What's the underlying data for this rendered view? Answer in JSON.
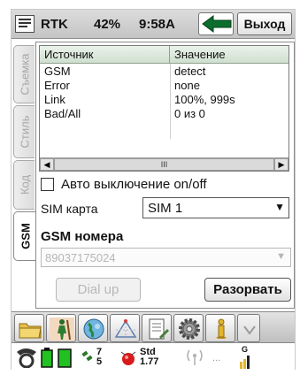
{
  "titlebar": {
    "app_name": "RTK",
    "battery": "42%",
    "time": "9:58A",
    "exit_label": "Выход"
  },
  "tabs": [
    {
      "label": "Съемка",
      "active": false
    },
    {
      "label": "Стиль",
      "active": false
    },
    {
      "label": "Код",
      "active": false
    },
    {
      "label": "GSM",
      "active": true
    }
  ],
  "grid": {
    "headers": [
      "Источник",
      "Значение"
    ],
    "rows": [
      [
        "GSM",
        "detect"
      ],
      [
        "Error",
        "none"
      ],
      [
        "Link",
        "100%, 999s"
      ],
      [
        "Bad/All",
        "0 из 0"
      ]
    ]
  },
  "auto_off_label": "Авто выключение on/off",
  "auto_off_checked": false,
  "sim": {
    "label": "SIM карта",
    "value": "SIM 1"
  },
  "gsm_numbers": {
    "title": "GSM номера",
    "value": "89037175024"
  },
  "buttons": {
    "dial": "Dial up",
    "break": "Разорвать"
  },
  "toolbar_icons": [
    "folder-icon",
    "surveyor-icon",
    "globe-icon",
    "cogo-icon",
    "notebook-icon",
    "settings-gear-icon",
    "info-icon"
  ],
  "status": {
    "sats_top": "7",
    "sats_bottom": "5",
    "std_label": "Std",
    "std_value": "1.77",
    "dots": "...",
    "gsm_letter": "G"
  },
  "colors": {
    "grid_header": "#d8e8d8",
    "back_arrow": "#0b6e2e",
    "battery_green": "#22c022",
    "accent_gold": "#e3b52c"
  }
}
